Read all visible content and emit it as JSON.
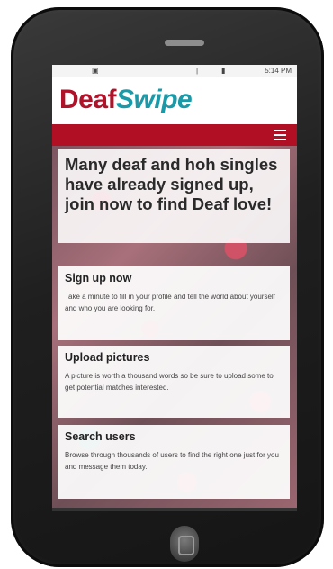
{
  "statusbar": {
    "time": "5:14 PM",
    "icons": [
      "notification-icon",
      "vibrate-icon",
      "battery-icon"
    ]
  },
  "brand": {
    "logo_part1": "Deaf",
    "logo_part2": "Swipe"
  },
  "colors": {
    "brand_red": "#b10f23",
    "logo_teal": "#1a9aa8",
    "logo_red": "#b0122a"
  },
  "hero": {
    "headline": "Many deaf and hoh singles have already signed up, join now to find Deaf love!"
  },
  "cards": [
    {
      "title": "Sign up now",
      "body": "Take a minute to fill in your profile and tell the world about yourself and who you are looking for."
    },
    {
      "title": "Upload pictures",
      "body": "A picture is worth a thousand words so be sure to upload some to get potential matches interested."
    },
    {
      "title": "Search users",
      "body": "Browse through thousands of users to find the right one just for you and message them today."
    }
  ]
}
